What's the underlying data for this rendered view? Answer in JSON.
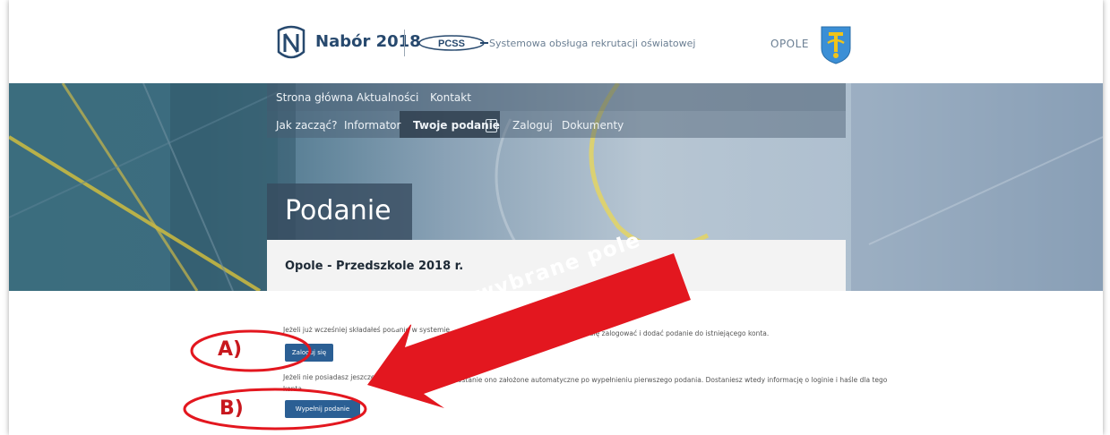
{
  "header": {
    "brand": "Nabór 2018",
    "pcss_logo_text": "PCSS",
    "tagline": "Systemowa obsługa rekrutacji oświatowej",
    "city": "OPOLE"
  },
  "nav_primary": [
    "Strona główna",
    "Aktualności",
    "Kontakt"
  ],
  "nav_secondary": [
    "Jak zacząć?",
    "Informator",
    "Twoje podanie",
    "Zaloguj",
    "Dokumenty"
  ],
  "page": {
    "title": "Podanie",
    "subtitle": "Opole - Przedszkole 2018 r."
  },
  "content": {
    "text_a_left": "Jeżeli już wcześniej składałeś podanie w systemie",
    "text_a_right": "możesz się zalogować i dodać podanie do istniejącego konta.",
    "button_a": "Zaloguj się",
    "text_b_left": "Jeżeli nie posiadasz jeszcze",
    "text_b_right": "zostanie ono założone automatyczne po wypełnieniu pierwszego podania. Dostaniesz wtedy informację o loginie i haśle dla tego",
    "text_b_line2": "konta.",
    "button_b": "Wypełnij podanie"
  },
  "annotations": {
    "label_a": "A)",
    "label_b": "B)",
    "callout": "Kliknij wybrane pole",
    "color": "#e3171f"
  },
  "colors": {
    "primary_button": "#2b5f94",
    "brand": "#27496e"
  }
}
